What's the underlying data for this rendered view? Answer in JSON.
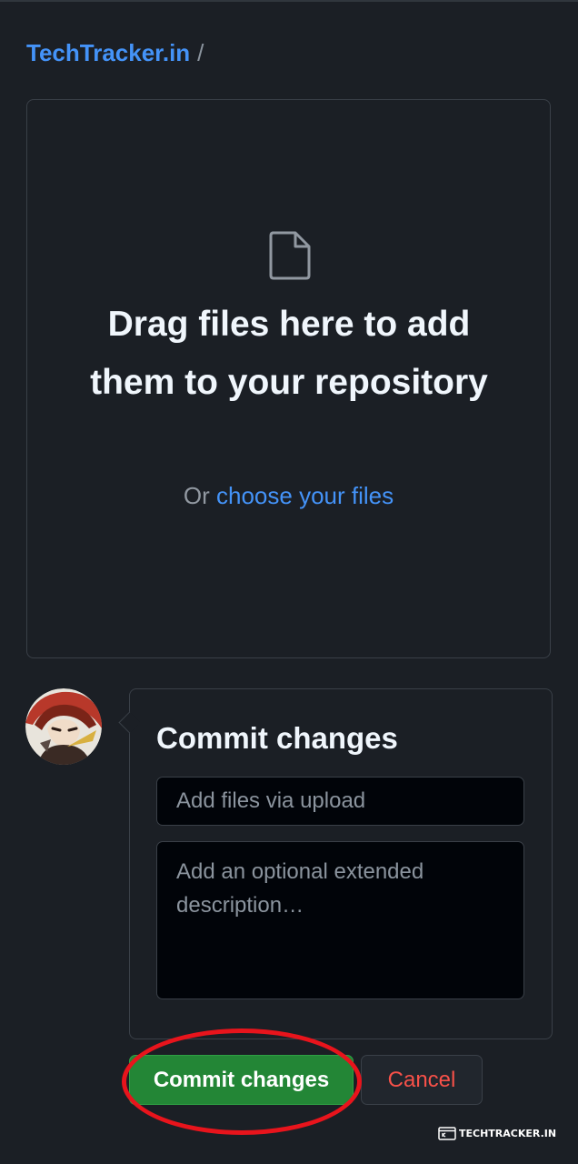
{
  "breadcrumb": {
    "repo_name": "TechTracker.in",
    "separator": "/"
  },
  "dropzone": {
    "icon": "file-icon",
    "title": "Drag files here to add them to your repository",
    "subtitle_prefix": "Or",
    "choose_link": "choose your files"
  },
  "commit": {
    "avatar": "user-avatar",
    "title": "Commit changes",
    "summary_placeholder": "Add files via upload",
    "description_placeholder": "Add an optional extended description…",
    "commit_button": "Commit changes",
    "cancel_button": "Cancel",
    "highlight_color": "#e8141c"
  },
  "colors": {
    "background": "#1b1f25",
    "link": "#4493f8",
    "primary_button": "#238636",
    "danger_text": "#f85149"
  },
  "watermark": {
    "text": "TECHTRACKER.IN"
  }
}
